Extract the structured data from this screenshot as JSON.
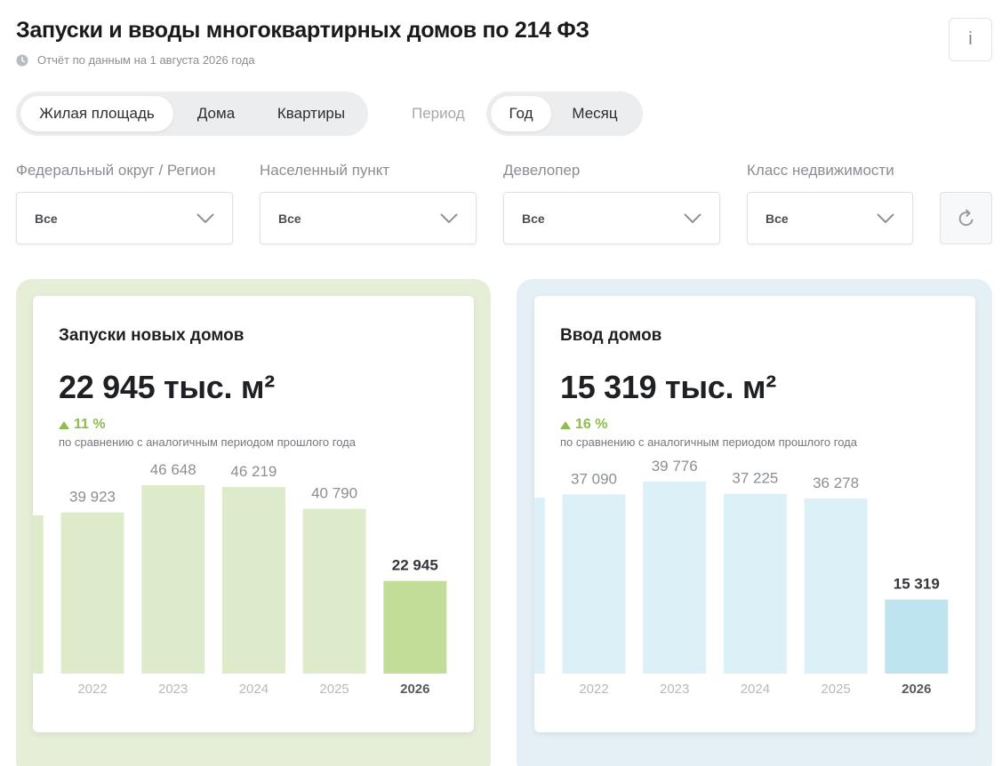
{
  "header": {
    "title": "Запуски и вводы многоквартирных домов по 214 ФЗ",
    "subtitle": "Отчёт по данным на 1 августа 2026 года",
    "info_label": "i"
  },
  "metric_tabs": [
    {
      "label": "Жилая площадь",
      "active": true
    },
    {
      "label": "Дома",
      "active": false
    },
    {
      "label": "Квартиры",
      "active": false
    }
  ],
  "period": {
    "label": "Период",
    "options": [
      {
        "label": "Год",
        "active": true
      },
      {
        "label": "Месяц",
        "active": false
      }
    ]
  },
  "filters": [
    {
      "label": "Федеральный округ / Регион",
      "value": "Все"
    },
    {
      "label": "Населенный пункт",
      "value": "Все"
    },
    {
      "label": "Девелопер",
      "value": "Все"
    },
    {
      "label": "Класс недвижимости",
      "value": "Все"
    }
  ],
  "cards": [
    {
      "title": "Запуски новых домов",
      "value": "22 945 тыс. м²",
      "change": "11 %",
      "compare": "по сравнению с аналогичным периодом прошлого года",
      "colors": {
        "panel": "#e6eed8",
        "bar": "#deebcb",
        "bar_current": "#c2dd98",
        "change": "#8bbd4f"
      }
    },
    {
      "title": "Ввод домов",
      "value": "15 319 тыс. м²",
      "change": "16 %",
      "compare": "по сравнению с аналогичным периодом прошлого года",
      "colors": {
        "panel": "#e4f0f5",
        "bar": "#dcf0f8",
        "bar_current": "#bee4f0",
        "change": "#8bbd4f"
      }
    }
  ],
  "chart_data": [
    {
      "type": "bar",
      "categories": [
        "2022",
        "2023",
        "2024",
        "2025",
        "2026"
      ],
      "values": [
        39923,
        46648,
        46219,
        40790,
        22945
      ],
      "value_labels": [
        "39 923",
        "46 648",
        "46 219",
        "40 790",
        "22 945"
      ],
      "highlight": "2026",
      "ylim": [
        0,
        55000
      ]
    },
    {
      "type": "bar",
      "categories": [
        "2022",
        "2023",
        "2024",
        "2025",
        "2026"
      ],
      "values": [
        37090,
        39776,
        37225,
        36278,
        15319
      ],
      "value_labels": [
        "37 090",
        "39 776",
        "37 225",
        "36 278",
        "15 319"
      ],
      "highlight": "2026",
      "ylim": [
        0,
        46000
      ]
    }
  ]
}
